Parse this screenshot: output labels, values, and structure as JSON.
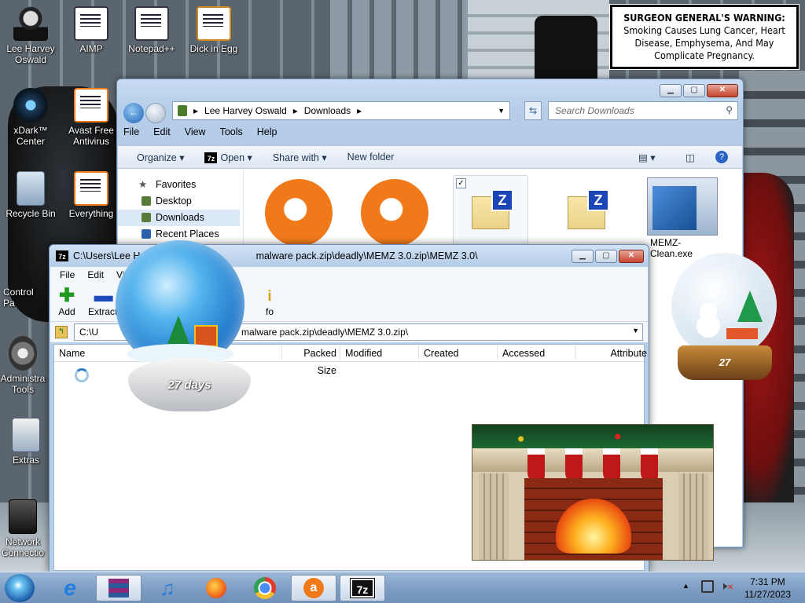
{
  "desktop": {
    "icons": [
      {
        "label": "Lee Harvey Oswald",
        "icon": "person-icon"
      },
      {
        "label": "AIMP",
        "icon": "document-icon"
      },
      {
        "label": "Notepad++",
        "icon": "notepad-icon"
      },
      {
        "label": "Dick in Egg",
        "icon": "document-icon"
      },
      {
        "label": "xDark™ Center",
        "icon": "xdark-icon"
      },
      {
        "label": "Avast Free Antivirus",
        "icon": "avast-icon"
      },
      {
        "label": "Recycle Bin",
        "icon": "recycle-bin-icon"
      },
      {
        "label": "Everything",
        "icon": "document-icon"
      },
      {
        "label": "Control Pa",
        "icon": "control-panel-icon"
      },
      {
        "label": "Administra Tools",
        "icon": "admin-tools-icon"
      },
      {
        "label": "Extras",
        "icon": "extras-icon"
      },
      {
        "label": "Network Connectio",
        "icon": "network-icon"
      }
    ],
    "warning_bold": "SURGEON GENERAL'S WARNING:",
    "warning_text": " Smoking Causes Lung Cancer, Heart Disease, Emphysema, And May Complicate Pregnancy."
  },
  "explorer": {
    "breadcrumb": [
      "Lee Harvey Oswald",
      "Downloads"
    ],
    "search_placeholder": "Search Downloads",
    "menu": [
      "File",
      "Edit",
      "View",
      "Tools",
      "Help"
    ],
    "toolbar": [
      "Organize",
      "Open",
      "Share with",
      "New folder"
    ],
    "nav": [
      "Favorites",
      "Desktop",
      "Downloads",
      "Recent Places"
    ],
    "files": [
      {
        "name": "",
        "type": "avast"
      },
      {
        "name": "",
        "type": "avast"
      },
      {
        "name": "",
        "type": "zip",
        "checked": true
      },
      {
        "name": "",
        "type": "zip"
      },
      {
        "name": "MEMZ-Clean.exe",
        "type": "exe"
      }
    ]
  },
  "sevenzip": {
    "title_left": "C:\\Users\\Lee Har",
    "title_right": "malware pack.zip\\deadly\\MEMZ 3.0.zip\\MEMZ 3.0\\",
    "menu": [
      "File",
      "Edit",
      "View"
    ],
    "tools": [
      {
        "label": "Add",
        "icon": "plus-icon"
      },
      {
        "label": "Extract",
        "icon": "minus-icon"
      },
      {
        "label": "fo",
        "icon": "info-icon"
      }
    ],
    "path_left": "C:\\U",
    "path_right": "malware pack.zip\\deadly\\MEMZ 3.0.zip\\",
    "columns": [
      "Name",
      "Packed Size",
      "Modified",
      "Created",
      "Accessed",
      "Attribute"
    ]
  },
  "widgets": {
    "globe_days": "27 days",
    "globe2_days": "27"
  },
  "taskbar": {
    "items": [
      "start-orb-icon",
      "internet-explorer-icon",
      "winrar-icon",
      "music-icon",
      "firefox-icon",
      "chrome-icon",
      "avast-icon",
      "7zip-icon"
    ],
    "time": "7:31 PM",
    "date": "11/27/2023"
  },
  "colors": {
    "avast": "#f07a1a",
    "accent": "#1b73c6"
  }
}
